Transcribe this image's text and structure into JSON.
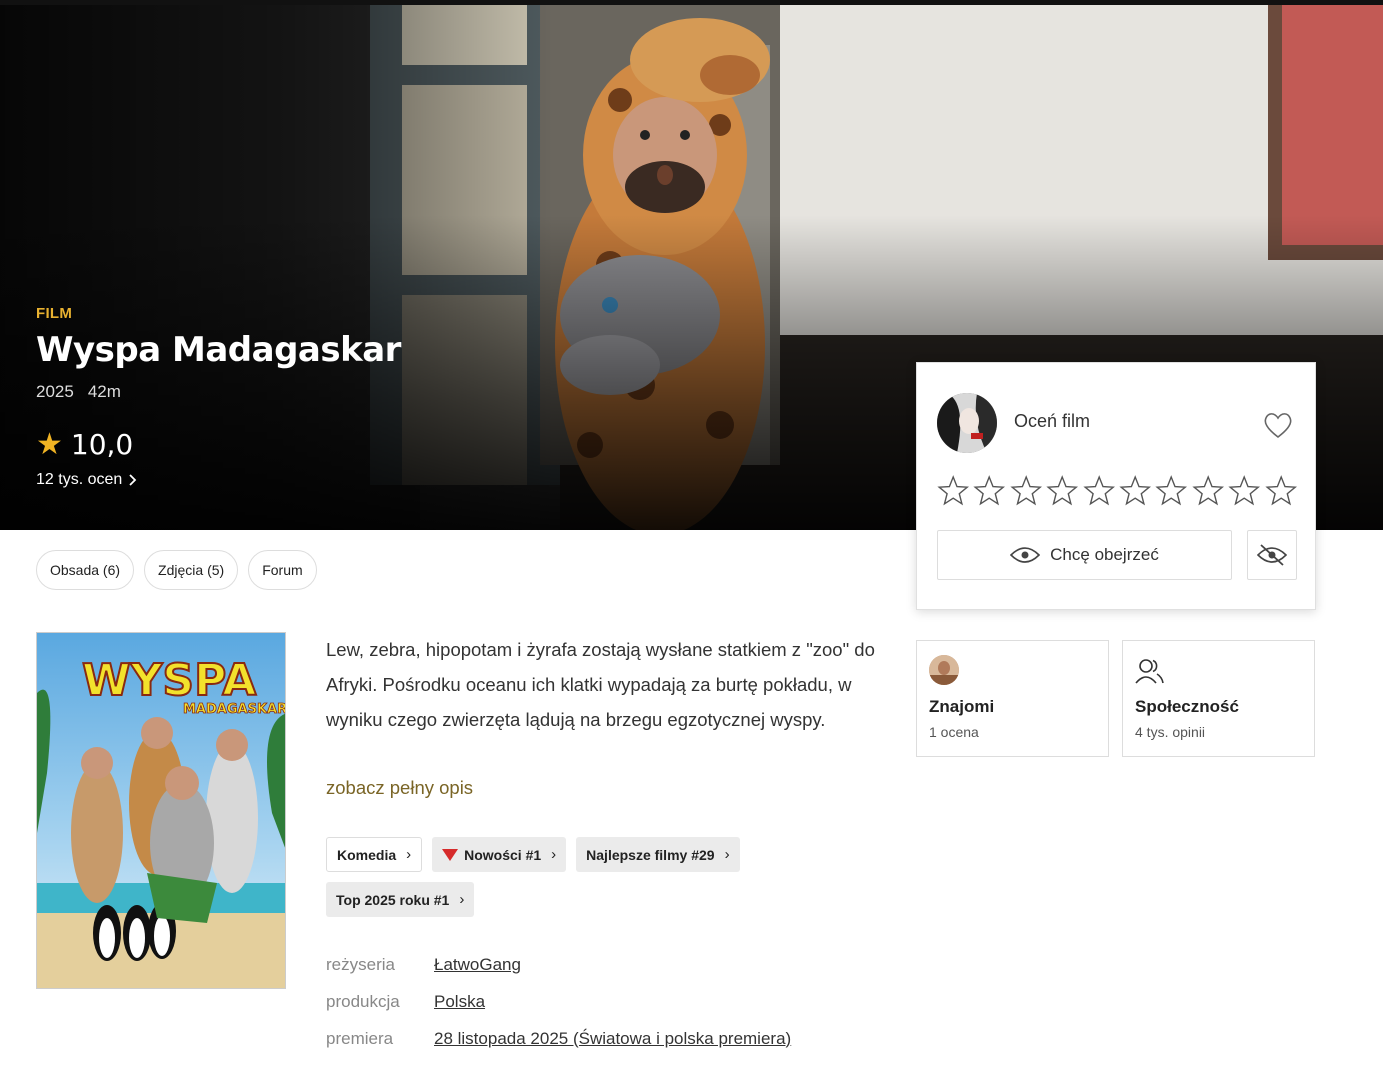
{
  "hero": {
    "type_label": "FILM",
    "title": "Wyspa Madagaskar",
    "year": "2025",
    "duration": "42m",
    "rating": "10,0",
    "rating_count": "12 tys.  ocen"
  },
  "tabs": [
    {
      "label": "Obsada (6)"
    },
    {
      "label": "Zdjęcia (5)"
    },
    {
      "label": "Forum"
    }
  ],
  "poster": {
    "title_line1": "WYSPA",
    "title_line2": "MADAGASKAR"
  },
  "description": "Lew, zebra, hipopotam i żyrafa zostają wysłane statkiem z \"zoo\" do Afryki. Pośrodku oceanu ich klatki wypadają za burtę pokładu, w wyniku czego zwierzęta lądują na brzegu egzotycznej wyspy.",
  "more_link": "zobacz pełny opis",
  "chips": {
    "genre": "Komedia",
    "new": "Nowości #1",
    "best": "Najlepsze filmy #29",
    "top": "Top 2025 roku #1"
  },
  "info": {
    "director_label": "reżyseria",
    "director": "ŁatwoGang",
    "production_label": "produkcja",
    "production": "Polska",
    "premiere_label": "premiera",
    "premiere": "28 listopada 2025 (Światowa i polska premiera)"
  },
  "rate_card": {
    "title": "Oceń film",
    "star_count": 10,
    "want_label": "Chcę obejrzeć"
  },
  "friends": {
    "title": "Znajomi",
    "sub": "1 ocena"
  },
  "community": {
    "title": "Społeczność",
    "sub": "4 tys. opinii"
  },
  "colors": {
    "accent_gold": "#e8b130",
    "rating_star": "#f0b323",
    "link_olive": "#7a6526",
    "trend_red": "#d62b2b"
  }
}
